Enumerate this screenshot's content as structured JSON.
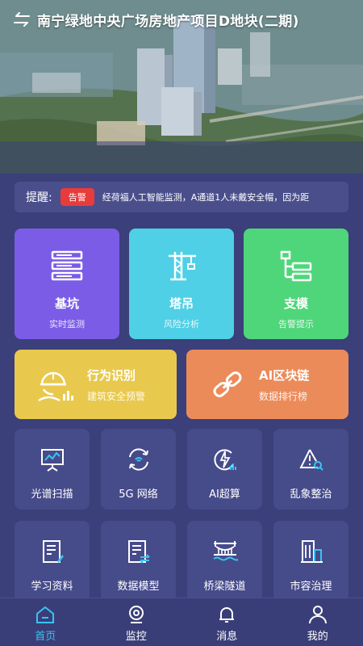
{
  "header": {
    "title": "南宁绿地中央广场房地产项目D地块(二期)",
    "back_icon": "swap-arrows-icon"
  },
  "notice": {
    "label": "提醒:",
    "badge": "告警",
    "message": "经荷福人工智能监测，A通道1人未戴安全帽，因为距"
  },
  "feature_cards": [
    {
      "title": "基坑",
      "subtitle": "实时监测",
      "color": "#7b5ce6",
      "icon": "server-stack-icon"
    },
    {
      "title": "塔吊",
      "subtitle": "风险分析",
      "color": "#4fd0e6",
      "icon": "tower-crane-icon"
    },
    {
      "title": "支模",
      "subtitle": "告警提示",
      "color": "#4fd67a",
      "icon": "structure-tree-icon"
    }
  ],
  "wide_cards": [
    {
      "title": "行为识别",
      "subtitle": "建筑安全预警",
      "color": "#e8c94e",
      "icon": "helmet-worker-icon"
    },
    {
      "title": "AI区块链",
      "subtitle": "数据排行榜",
      "color": "#ec8b5a",
      "icon": "chain-link-icon"
    }
  ],
  "tiles": [
    {
      "label": "光谱扫描",
      "icon": "spectrum-board-icon"
    },
    {
      "label": "5G 网络",
      "icon": "network-sync-icon"
    },
    {
      "label": "AI超算",
      "icon": "lightning-chart-icon"
    },
    {
      "label": "乱象整治",
      "icon": "warning-search-icon"
    },
    {
      "label": "学习资料",
      "icon": "document-edit-icon"
    },
    {
      "label": "数据模型",
      "icon": "data-exchange-icon"
    },
    {
      "label": "桥梁隧道",
      "icon": "bridge-icon"
    },
    {
      "label": "市容治理",
      "icon": "city-building-icon"
    }
  ],
  "tabbar": [
    {
      "label": "首页",
      "icon": "home-icon",
      "active": true
    },
    {
      "label": "监控",
      "icon": "camera-icon",
      "active": false
    },
    {
      "label": "消息",
      "icon": "bell-icon",
      "active": false
    },
    {
      "label": "我的",
      "icon": "user-icon",
      "active": false
    }
  ],
  "colors": {
    "background": "#3b3f7a",
    "tile": "#464b8a",
    "alert": "#e83b3b",
    "tab_active": "#38c4f2"
  }
}
